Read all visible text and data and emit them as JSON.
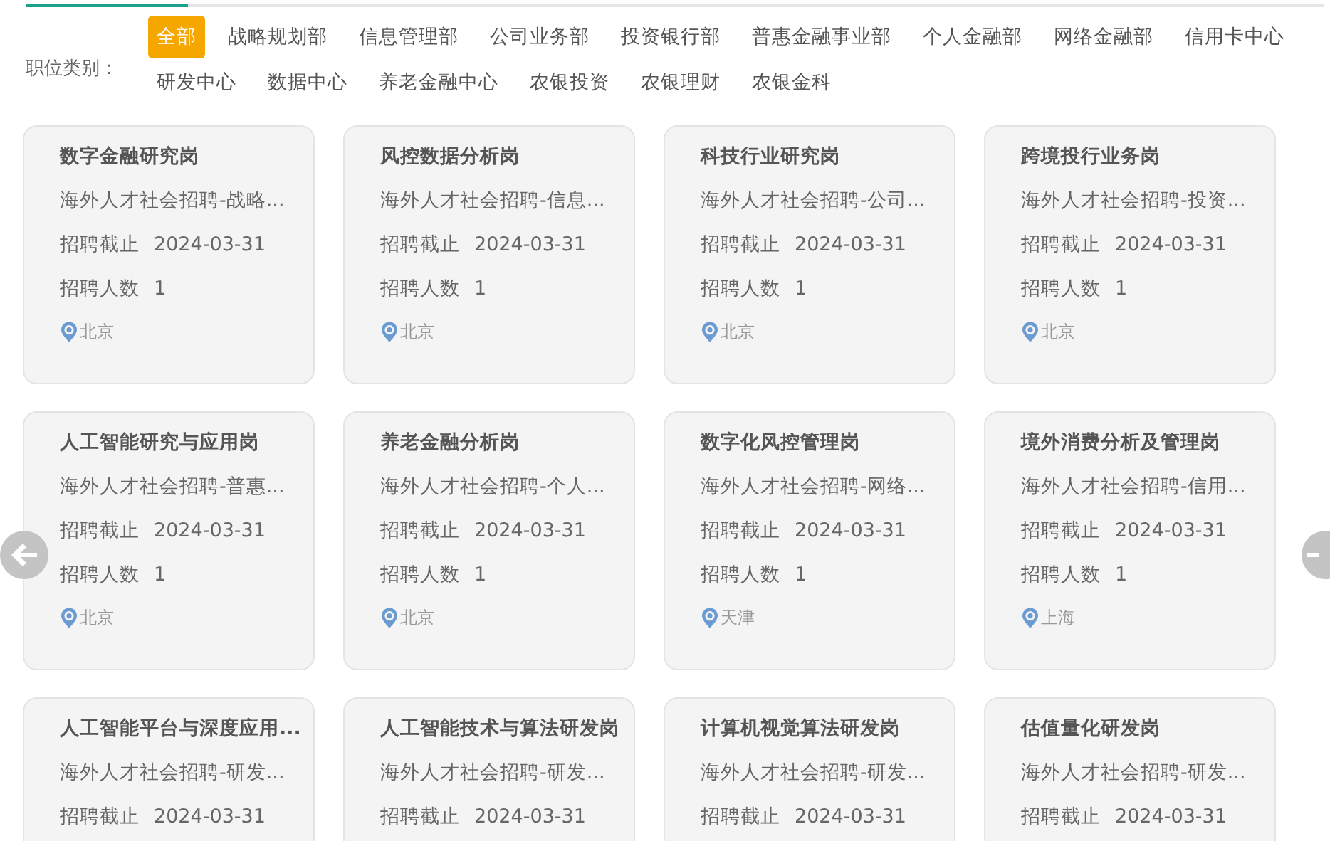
{
  "filter": {
    "label": "职位类别：",
    "categories": [
      {
        "label": "全部",
        "selected": true
      },
      {
        "label": "战略规划部",
        "selected": false
      },
      {
        "label": "信息管理部",
        "selected": false
      },
      {
        "label": "公司业务部",
        "selected": false
      },
      {
        "label": "投资银行部",
        "selected": false
      },
      {
        "label": "普惠金融事业部",
        "selected": false
      },
      {
        "label": "个人金融部",
        "selected": false
      },
      {
        "label": "网络金融部",
        "selected": false
      },
      {
        "label": "信用卡中心",
        "selected": false
      },
      {
        "label": "研发中心",
        "selected": false
      },
      {
        "label": "数据中心",
        "selected": false
      },
      {
        "label": "养老金融中心",
        "selected": false
      },
      {
        "label": "农银投资",
        "selected": false
      },
      {
        "label": "农银理财",
        "selected": false
      },
      {
        "label": "农银金科",
        "selected": false
      }
    ]
  },
  "jobs": [
    {
      "title": "数字金融研究岗",
      "description": "海外人才社会招聘-战略...",
      "deadline_label": "招聘截止",
      "deadline": "2024-03-31",
      "count_label": "招聘人数",
      "count": "1",
      "location": "北京"
    },
    {
      "title": "风控数据分析岗",
      "description": "海外人才社会招聘-信息...",
      "deadline_label": "招聘截止",
      "deadline": "2024-03-31",
      "count_label": "招聘人数",
      "count": "1",
      "location": "北京"
    },
    {
      "title": "科技行业研究岗",
      "description": "海外人才社会招聘-公司...",
      "deadline_label": "招聘截止",
      "deadline": "2024-03-31",
      "count_label": "招聘人数",
      "count": "1",
      "location": "北京"
    },
    {
      "title": "跨境投行业务岗",
      "description": "海外人才社会招聘-投资...",
      "deadline_label": "招聘截止",
      "deadline": "2024-03-31",
      "count_label": "招聘人数",
      "count": "1",
      "location": "北京"
    },
    {
      "title": "人工智能研究与应用岗",
      "description": "海外人才社会招聘-普惠...",
      "deadline_label": "招聘截止",
      "deadline": "2024-03-31",
      "count_label": "招聘人数",
      "count": "1",
      "location": "北京"
    },
    {
      "title": "养老金融分析岗",
      "description": "海外人才社会招聘-个人...",
      "deadline_label": "招聘截止",
      "deadline": "2024-03-31",
      "count_label": "招聘人数",
      "count": "1",
      "location": "北京"
    },
    {
      "title": "数字化风控管理岗",
      "description": "海外人才社会招聘-网络...",
      "deadline_label": "招聘截止",
      "deadline": "2024-03-31",
      "count_label": "招聘人数",
      "count": "1",
      "location": "天津"
    },
    {
      "title": "境外消费分析及管理岗",
      "description": "海外人才社会招聘-信用...",
      "deadline_label": "招聘截止",
      "deadline": "2024-03-31",
      "count_label": "招聘人数",
      "count": "1",
      "location": "上海"
    },
    {
      "title": "人工智能平台与深度应用...",
      "description": "海外人才社会招聘-研发...",
      "deadline_label": "招聘截止",
      "deadline": "2024-03-31"
    },
    {
      "title": "人工智能技术与算法研发岗",
      "description": "海外人才社会招聘-研发...",
      "deadline_label": "招聘截止",
      "deadline": "2024-03-31"
    },
    {
      "title": "计算机视觉算法研发岗",
      "description": "海外人才社会招聘-研发...",
      "deadline_label": "招聘截止",
      "deadline": "2024-03-31"
    },
    {
      "title": "估值量化研发岗",
      "description": "海外人才社会招聘-研发...",
      "deadline_label": "招聘截止",
      "deadline": "2024-03-31"
    }
  ]
}
